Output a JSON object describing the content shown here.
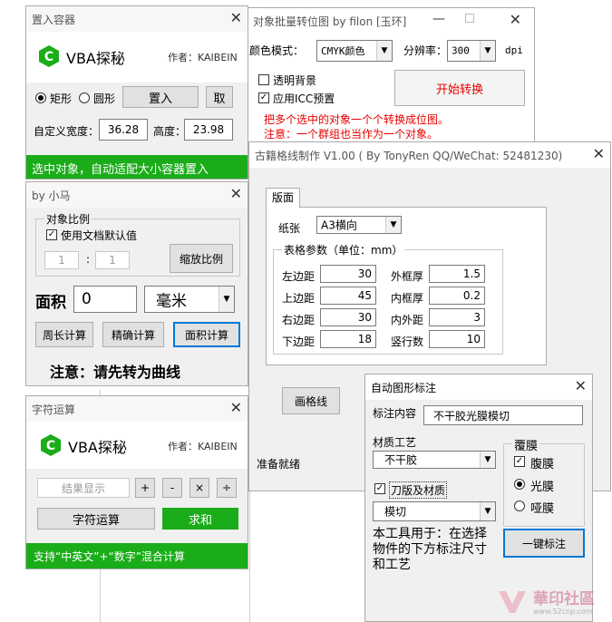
{
  "win_container": {
    "title": "置入容器",
    "brand": "VBA探秘",
    "author": "作者：KAIBEIN",
    "radio_rect": "矩形",
    "radio_circle": "圆形",
    "place_button": "置入",
    "get_button": "取",
    "width_label": "自定义宽度：",
    "width_value": "36.28",
    "height_label": "高度：",
    "height_value": "23.98",
    "status": "选中对象，自动适配大小容器置入"
  },
  "win_bitmap": {
    "title": "对象批量转位图 by filon [玉环]",
    "color_mode_label": "颜色模式：",
    "color_mode_value": "CMYK颜色",
    "dpi_label": "分辨率：",
    "dpi_value": "300",
    "dpi_unit": "dpi",
    "transparent_bg": "透明背景",
    "icc_preset": "应用ICC预置",
    "start_button": "开始转换",
    "note1": "把多个选中的对象一个个转换成位图。",
    "note2": "注意：一个群组也当作为一个对象。"
  },
  "win_scale": {
    "title": "by 小马",
    "group_title": "对象比例",
    "default_doc": "使用文档默认值",
    "ratio_a": "1",
    "ratio_sep": ":",
    "ratio_b": "1",
    "scale_button": "缩放比例",
    "area_label": "面积",
    "area_value": "0",
    "unit_value": "毫米",
    "perimeter_button": "周长计算",
    "precise_button": "精确计算",
    "area_button": "面积计算",
    "warning": "注意：请先转为曲线"
  },
  "win_grid": {
    "title": "古籍格线制作 V1.00 ( By TonyRen QQ/WeChat: 52481230)",
    "tab": "版面",
    "paper_label": "纸张",
    "paper_value": "A3横向",
    "params_title": "表格参数（单位：mm）",
    "left_margin_label": "左边距",
    "left_margin": "30",
    "outer_thick_label": "外框厚",
    "outer_thick": "1.5",
    "top_margin_label": "上边距",
    "top_margin": "45",
    "inner_thick_label": "内框厚",
    "inner_thick": "0.2",
    "right_margin_label": "右边距",
    "right_margin": "30",
    "inout_label": "内外距",
    "inout": "3",
    "bottom_margin_label": "下边距",
    "bottom_margin": "18",
    "cols_label": "竖行数",
    "cols": "10",
    "draw_button": "画格线",
    "status": "准备就绪"
  },
  "win_calc": {
    "title": "字符运算",
    "brand": "VBA探秘",
    "author": "作者：KAIBEIN",
    "result_placeholder": "结果显示",
    "op_plus": "+",
    "op_minus": "-",
    "op_times": "×",
    "op_divide": "÷",
    "calc_button": "字符运算",
    "sum_button": "求和",
    "status": "支持“中英文”+“数字”混合计算"
  },
  "win_label": {
    "title": "自动图形标注",
    "content_label": "标注内容",
    "content_value": "不干胶光膜模切",
    "material_label": "材质工艺",
    "material_value": "不干胶",
    "laminate_title": "覆膜",
    "opt_laminate": "腹膜",
    "opt_gloss": "光膜",
    "opt_matte": "哑膜",
    "die_check": "刀版及材质",
    "die_value": "模切",
    "description": "本工具用于：在选择物件的下方标注尺寸和工艺",
    "one_click_button": "一键标注"
  },
  "watermark": {
    "text": "華印社區",
    "url": "www.52cnp.com"
  },
  "colors": {
    "accent_green": "#1aad19",
    "red_text": "#e60000",
    "focus_blue": "#0078d7"
  }
}
